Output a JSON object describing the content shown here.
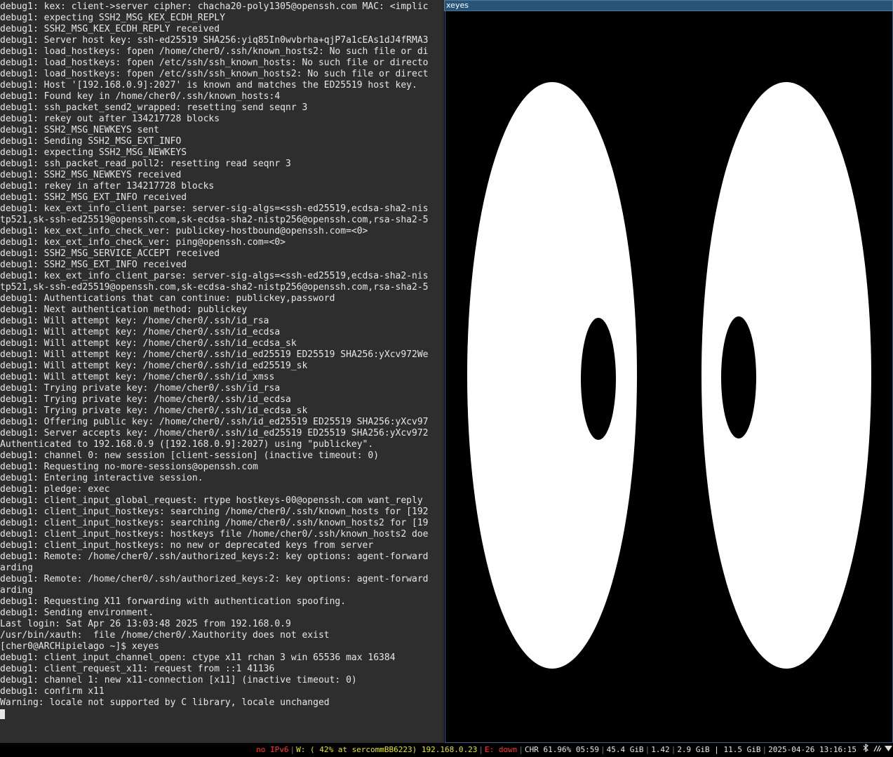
{
  "terminal": {
    "lines": [
      "debug1: kex: client->server cipher: chacha20-poly1305@openssh.com MAC: <implic",
      "debug1: expecting SSH2_MSG_KEX_ECDH_REPLY",
      "debug1: SSH2_MSG_KEX_ECDH_REPLY received",
      "debug1: Server host key: ssh-ed25519 SHA256:yiq85In0wvbrha+qjP7a1cEAs1dJ4fRMA3",
      "debug1: load_hostkeys: fopen /home/cher0/.ssh/known_hosts2: No such file or di",
      "debug1: load_hostkeys: fopen /etc/ssh/ssh_known_hosts: No such file or directo",
      "debug1: load_hostkeys: fopen /etc/ssh/ssh_known_hosts2: No such file or direct",
      "debug1: Host '[192.168.0.9]:2027' is known and matches the ED25519 host key.",
      "debug1: Found key in /home/cher0/.ssh/known_hosts:4",
      "debug1: ssh_packet_send2_wrapped: resetting send seqnr 3",
      "debug1: rekey out after 134217728 blocks",
      "debug1: SSH2_MSG_NEWKEYS sent",
      "debug1: Sending SSH2_MSG_EXT_INFO",
      "debug1: expecting SSH2_MSG_NEWKEYS",
      "debug1: ssh_packet_read_poll2: resetting read seqnr 3",
      "debug1: SSH2_MSG_NEWKEYS received",
      "debug1: rekey in after 134217728 blocks",
      "debug1: SSH2_MSG_EXT_INFO received",
      "debug1: kex_ext_info_client_parse: server-sig-algs=<ssh-ed25519,ecdsa-sha2-nis",
      "tp521,sk-ssh-ed25519@openssh.com,sk-ecdsa-sha2-nistp256@openssh.com,rsa-sha2-5",
      "debug1: kex_ext_info_check_ver: publickey-hostbound@openssh.com=<0>",
      "debug1: kex_ext_info_check_ver: ping@openssh.com=<0>",
      "debug1: SSH2_MSG_SERVICE_ACCEPT received",
      "debug1: SSH2_MSG_EXT_INFO received",
      "debug1: kex_ext_info_client_parse: server-sig-algs=<ssh-ed25519,ecdsa-sha2-nis",
      "tp521,sk-ssh-ed25519@openssh.com,sk-ecdsa-sha2-nistp256@openssh.com,rsa-sha2-5",
      "debug1: Authentications that can continue: publickey,password",
      "debug1: Next authentication method: publickey",
      "debug1: Will attempt key: /home/cher0/.ssh/id_rsa",
      "debug1: Will attempt key: /home/cher0/.ssh/id_ecdsa",
      "debug1: Will attempt key: /home/cher0/.ssh/id_ecdsa_sk",
      "debug1: Will attempt key: /home/cher0/.ssh/id_ed25519 ED25519 SHA256:yXcv972We",
      "debug1: Will attempt key: /home/cher0/.ssh/id_ed25519_sk",
      "debug1: Will attempt key: /home/cher0/.ssh/id_xmss",
      "debug1: Trying private key: /home/cher0/.ssh/id_rsa",
      "debug1: Trying private key: /home/cher0/.ssh/id_ecdsa",
      "debug1: Trying private key: /home/cher0/.ssh/id_ecdsa_sk",
      "debug1: Offering public key: /home/cher0/.ssh/id_ed25519 ED25519 SHA256:yXcv97",
      "debug1: Server accepts key: /home/cher0/.ssh/id_ed25519 ED25519 SHA256:yXcv972",
      "Authenticated to 192.168.0.9 ([192.168.0.9]:2027) using \"publickey\".",
      "debug1: channel 0: new session [client-session] (inactive timeout: 0)",
      "debug1: Requesting no-more-sessions@openssh.com",
      "debug1: Entering interactive session.",
      "debug1: pledge: exec",
      "debug1: client_input_global_request: rtype hostkeys-00@openssh.com want_reply",
      "debug1: client_input_hostkeys: searching /home/cher0/.ssh/known_hosts for [192",
      "debug1: client_input_hostkeys: searching /home/cher0/.ssh/known_hosts2 for [19",
      "debug1: client_input_hostkeys: hostkeys file /home/cher0/.ssh/known_hosts2 doe",
      "debug1: client_input_hostkeys: no new or deprecated keys from server",
      "debug1: Remote: /home/cher0/.ssh/authorized_keys:2: key options: agent-forward",
      "arding",
      "debug1: Remote: /home/cher0/.ssh/authorized_keys:2: key options: agent-forward",
      "arding",
      "debug1: Requesting X11 forwarding with authentication spoofing.",
      "debug1: Sending environment.",
      "Last login: Sat Apr 26 13:03:48 2025 from 192.168.0.9",
      "/usr/bin/xauth:  file /home/cher0/.Xauthority does not exist",
      "[cher0@ARCHipielago ~]$ xeyes",
      "debug1: client_input_channel_open: ctype x11 rchan 3 win 65536 max 16384",
      "debug1: client_request_x11: request from ::1 41136",
      "debug1: channel 1: new x11-connection [x11] (inactive timeout: 0)",
      "debug1: confirm x11",
      "Warning: locale not supported by C library, locale unchanged"
    ]
  },
  "xeyes": {
    "title": "xeyes"
  },
  "statusbar": {
    "ipv6": "no IPv6",
    "wireless": "W: ( 42% at sercommBB6223) 192.168.0.23",
    "ethernet": "E: down",
    "battery": "CHR 61.96% 05:59",
    "disk": "45.4 GiB",
    "load": "1.42",
    "memory": "2.9 GiB | 11.5 GiB",
    "datetime": "2025-04-26 13:16:15",
    "colors": {
      "ipv6": "#ff3333",
      "wireless": "#e6e600",
      "ethernet": "#ff3333",
      "normal": "#e6e6e6"
    },
    "tray_icons": [
      "bluetooth-icon",
      "network-icon",
      "wifi-icon"
    ]
  }
}
